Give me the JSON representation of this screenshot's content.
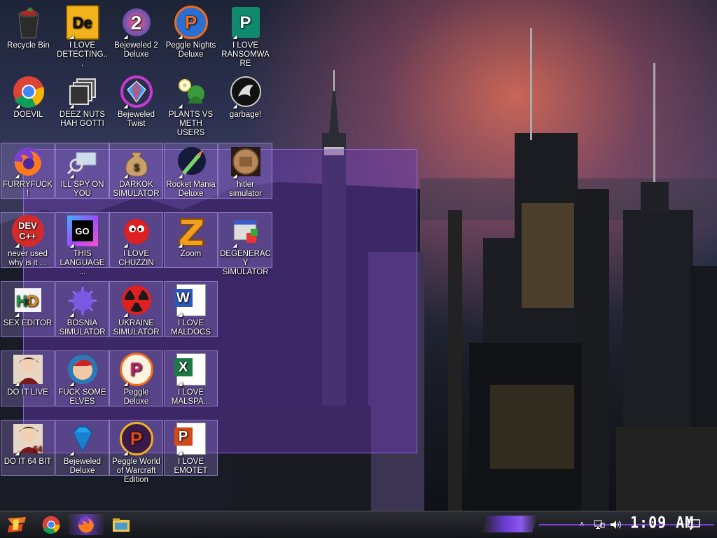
{
  "desktop": {
    "icons": [
      {
        "label": "Recycle Bin"
      },
      {
        "label": "I LOVE DETECTING..."
      },
      {
        "label": "Bejeweled 2 Deluxe"
      },
      {
        "label": "Peggle Nights Deluxe"
      },
      {
        "label": "I LOVE RANSOMWARE"
      },
      {
        "label": "DOEVIL"
      },
      {
        "label": "DEEZ NUTS HAH GOTTI"
      },
      {
        "label": "Bejeweled Twist"
      },
      {
        "label": "PLANTS VS METH USERS"
      },
      {
        "label": "garbage!"
      },
      {
        "label": "FURRYFUCK!"
      },
      {
        "label": "ILL SPY ON YOU"
      },
      {
        "label": "DARKOK SIMULATOR"
      },
      {
        "label": "Rocket Mania Deluxe"
      },
      {
        "label": "hitler simulator"
      },
      {
        "label": "never used why is it ..."
      },
      {
        "label": "THIS LANGUAGE ..."
      },
      {
        "label": "I LOVE CHUZZIN"
      },
      {
        "label": "Zoom"
      },
      {
        "label": "DEGENERACY SIMULATOR"
      },
      {
        "label": "SEX EDITOR"
      },
      {
        "label": "BOSNIA SIMULATOR"
      },
      {
        "label": "UKRAINE SIMULATOR"
      },
      {
        "label": "I LOVE MALDOCS"
      },
      {
        "label": "DO IT LIVE"
      },
      {
        "label": "FUCK SOME ELVES"
      },
      {
        "label": "Peggle Deluxe"
      },
      {
        "label": "I LOVE MALSPA..."
      },
      {
        "label": "DO IT 64 BIT"
      },
      {
        "label": "Bejeweled Deluxe"
      },
      {
        "label": "Peggle World of Warcraft Edition"
      },
      {
        "label": "I LOVE EMOTET"
      }
    ],
    "icon_texts": {
      "dev1": "DEV",
      "dev2": "C++",
      "go": "GO",
      "word": "W",
      "excel": "X",
      "ppt": "P",
      "de": "De",
      "bj2": "2"
    }
  },
  "taskbar": {
    "clock": "1:09 AM"
  },
  "colors": {
    "selection": "#6e3cbe",
    "accent": "#7b3fe4"
  }
}
